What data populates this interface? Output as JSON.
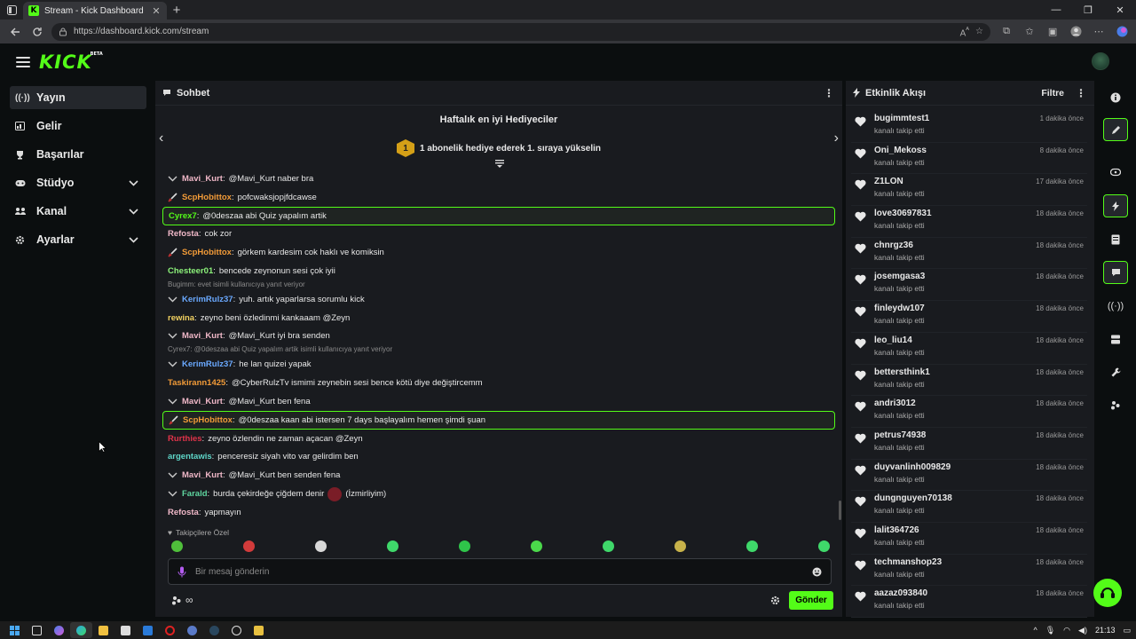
{
  "browser": {
    "tab_title": "Stream - Kick Dashboard",
    "url": "https://dashboard.kick.com/stream",
    "favicon_letter": "K"
  },
  "app": {
    "logo": "KICK",
    "logo_tag": "BETA"
  },
  "sidebar": {
    "items": [
      {
        "label": "Yayın",
        "icon": "broadcast-icon",
        "active": true
      },
      {
        "label": "Gelir",
        "icon": "revenue-icon"
      },
      {
        "label": "Başarılar",
        "icon": "trophy-icon"
      },
      {
        "label": "Stüdyo",
        "icon": "gamepad-icon",
        "expandable": true
      },
      {
        "label": "Kanal",
        "icon": "channel-icon",
        "expandable": true
      },
      {
        "label": "Ayarlar",
        "icon": "gear-icon",
        "expandable": true
      }
    ]
  },
  "chat": {
    "title": "Sohbet",
    "gifters_title": "Haftalık en iyi Hediyeciler",
    "gifters_badge": "1",
    "gifters_desc": "1 abonelik hediye ederek 1. sıraya yükselin",
    "messages": [
      {
        "user": "Mavi_Kurt",
        "color": "#f0b8c8",
        "text": "@Mavi_Kurt naber bra",
        "badge": "mod"
      },
      {
        "user": "ScpHobittox",
        "color": "#f29b38",
        "text": "pofcwaksjopjfdcawse",
        "badge": "sword"
      },
      {
        "user": "Cyrex7",
        "color": "#53fc18",
        "text": "@0deszaa abi Quiz yapalım artik",
        "highlight": true
      },
      {
        "user": "Refosta",
        "color": "#f0b8c8",
        "text": "cok zor"
      },
      {
        "user": "ScpHobittox",
        "color": "#f29b38",
        "text": "görkem kardesim cok haklı ve komiksin",
        "badge": "sword"
      },
      {
        "user": "Chesteer01",
        "color": "#8cf27a",
        "text": "bencede zeynonun sesi çok iyii"
      },
      {
        "reply": "Bugimm: evet isimli kullanıcıya yanıt veriyor",
        "user": "KerimRulz37",
        "color": "#6aa9ff",
        "text": "yuh. artık yaparlarsa sorumlu kick",
        "badge": "mod"
      },
      {
        "user": "rewina",
        "color": "#f0d060",
        "text": "zeyno beni özledinmi kankaaam @Zeyn"
      },
      {
        "user": "Mavi_Kurt",
        "color": "#f0b8c8",
        "text": "@Mavi_Kurt iyi bra senden",
        "badge": "mod"
      },
      {
        "reply": "Cyrex7: @0deszaa abi Quiz yapalım artik isimli kullanıcıya yanıt veriyor",
        "user": "KerimRulz37",
        "color": "#6aa9ff",
        "text": "he lan quizei yapak",
        "badge": "mod"
      },
      {
        "user": "Taskirann1425",
        "color": "#f29b38",
        "text": "@CyberRulzTv ismimi zeynebin sesi bence kötü diye değiştircemm"
      },
      {
        "user": "Mavi_Kurt",
        "color": "#f0b8c8",
        "text": "@Mavi_Kurt ben fena",
        "badge": "mod"
      },
      {
        "user": "ScpHobittox",
        "color": "#f29b38",
        "text": "@0deszaa kaan abi istersen 7 days başlayalım hemen şimdi şuan",
        "badge": "sword",
        "highlight": true
      },
      {
        "user": "Rurthies",
        "color": "#e0334a",
        "text": "zeyno özlendin ne zaman açacan @Zeyn"
      },
      {
        "user": "argentawis",
        "color": "#5fd6c8",
        "text": "penceresiz siyah vito var gelirdim ben"
      },
      {
        "user": "Mavi_Kurt",
        "color": "#f0b8c8",
        "text": "@Mavi_Kurt ben senden fena",
        "badge": "mod"
      },
      {
        "user": "Farald",
        "color": "#5fd6a0",
        "text": "burda çekirdeğe çiğdem denir",
        "badge": "mod",
        "emote": true,
        "text_after": "(İzmirliyim)"
      },
      {
        "user": "Refosta",
        "color": "#f0b8c8",
        "text": "yapmayın"
      }
    ],
    "followers_only": "Takipçilere Özel",
    "input_placeholder": "Bir mesaj gönderin",
    "send_label": "Gönder"
  },
  "activity": {
    "title": "Etkinlik Akışı",
    "filter_label": "Filtre",
    "items": [
      {
        "name": "bugimmtest1",
        "action": "kanalı takip etti",
        "time": "1 dakika önce"
      },
      {
        "name": "Oni_Mekoss",
        "action": "kanalı takip etti",
        "time": "8 dakika önce"
      },
      {
        "name": "Z1LON",
        "action": "kanalı takip etti",
        "time": "17 dakika önce"
      },
      {
        "name": "love30697831",
        "action": "kanalı takip etti",
        "time": "18 dakika önce"
      },
      {
        "name": "chnrgz36",
        "action": "kanalı takip etti",
        "time": "18 dakika önce"
      },
      {
        "name": "josemgasa3",
        "action": "kanalı takip etti",
        "time": "18 dakika önce"
      },
      {
        "name": "finleydw107",
        "action": "kanalı takip etti",
        "time": "18 dakika önce"
      },
      {
        "name": "leo_liu14",
        "action": "kanalı takip etti",
        "time": "18 dakika önce"
      },
      {
        "name": "bettersthink1",
        "action": "kanalı takip etti",
        "time": "18 dakika önce"
      },
      {
        "name": "andri3012",
        "action": "kanalı takip etti",
        "time": "18 dakika önce"
      },
      {
        "name": "petrus74938",
        "action": "kanalı takip etti",
        "time": "18 dakika önce"
      },
      {
        "name": "duyvanlinh009829",
        "action": "kanalı takip etti",
        "time": "18 dakika önce"
      },
      {
        "name": "dungnguyen70138",
        "action": "kanalı takip etti",
        "time": "18 dakika önce"
      },
      {
        "name": "lalit364726",
        "action": "kanalı takip etti",
        "time": "18 dakika önce"
      },
      {
        "name": "techmanshop23",
        "action": "kanalı takip etti",
        "time": "18 dakika önce"
      },
      {
        "name": "aazaz093840",
        "action": "kanalı takip etti",
        "time": "18 dakika önce"
      }
    ]
  },
  "taskbar": {
    "clock": "21:13"
  },
  "colors": {
    "accent": "#53fc18",
    "panel": "#191b1f",
    "background": "#0b0e0f"
  }
}
